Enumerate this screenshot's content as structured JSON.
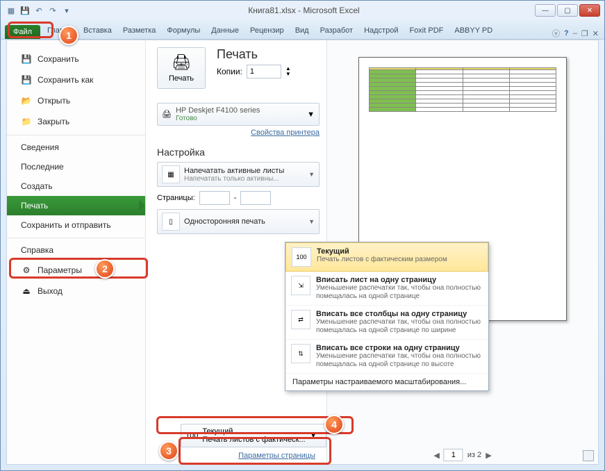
{
  "title": "Книга81.xlsx - Microsoft Excel",
  "tabs": [
    "Главна",
    "Вставка",
    "Разметка",
    "Формулы",
    "Данные",
    "Рецензир",
    "Вид",
    "Разработ",
    "Надстрой",
    "Foxit PDF",
    "ABBYY PD"
  ],
  "file_tab": "Файл",
  "nav": {
    "save": "Сохранить",
    "save_as": "Сохранить как",
    "open": "Открыть",
    "close": "Закрыть",
    "info": "Сведения",
    "recent": "Последние",
    "new": "Создать",
    "print": "Печать",
    "share": "Сохранить и отправить",
    "help": "Справка",
    "options": "Параметры",
    "exit": "Выход"
  },
  "print": {
    "header": "Печать",
    "btn": "Печать",
    "copies_label": "Копии:",
    "copies": "1",
    "printer_name": "HP Deskjet F4100 series",
    "printer_status": "Готово",
    "printer_props": "Свойства принтера",
    "settings_title": "Настройка",
    "active_sheets_t": "Напечатать активные листы",
    "active_sheets_d": "Напечатать только активны...",
    "pages_label": "Страницы:",
    "pages_sep": "-",
    "onesided_t": "Односторонняя печать",
    "page_setup": "Параметры страницы"
  },
  "scaling": {
    "current_t": "Текущий",
    "current_d": "Печать листов с фактическ...",
    "popup": {
      "o1_t": "Текущий",
      "o1_d": "Печать листов с фактическим размером",
      "o2_t": "Вписать лист на одну страницу",
      "o2_d": "Уменьшение распечатки так, чтобы она полностью помещалась на одной странице",
      "o3_t": "Вписать все столбцы на одну страницу",
      "o3_d": "Уменьшение распечатки так, чтобы она полностью помещалась на одной странице по ширине",
      "o4_t": "Вписать все строки на одну страницу",
      "o4_d": "Уменьшение распечатки так, чтобы она полностью помещалась на одной странице по высоте",
      "custom": "Параметры настраиваемого масштабирования..."
    }
  },
  "preview": {
    "page": "1",
    "total": "из 2"
  },
  "callouts": {
    "c1": "1",
    "c2": "2",
    "c3": "3",
    "c4": "4"
  }
}
